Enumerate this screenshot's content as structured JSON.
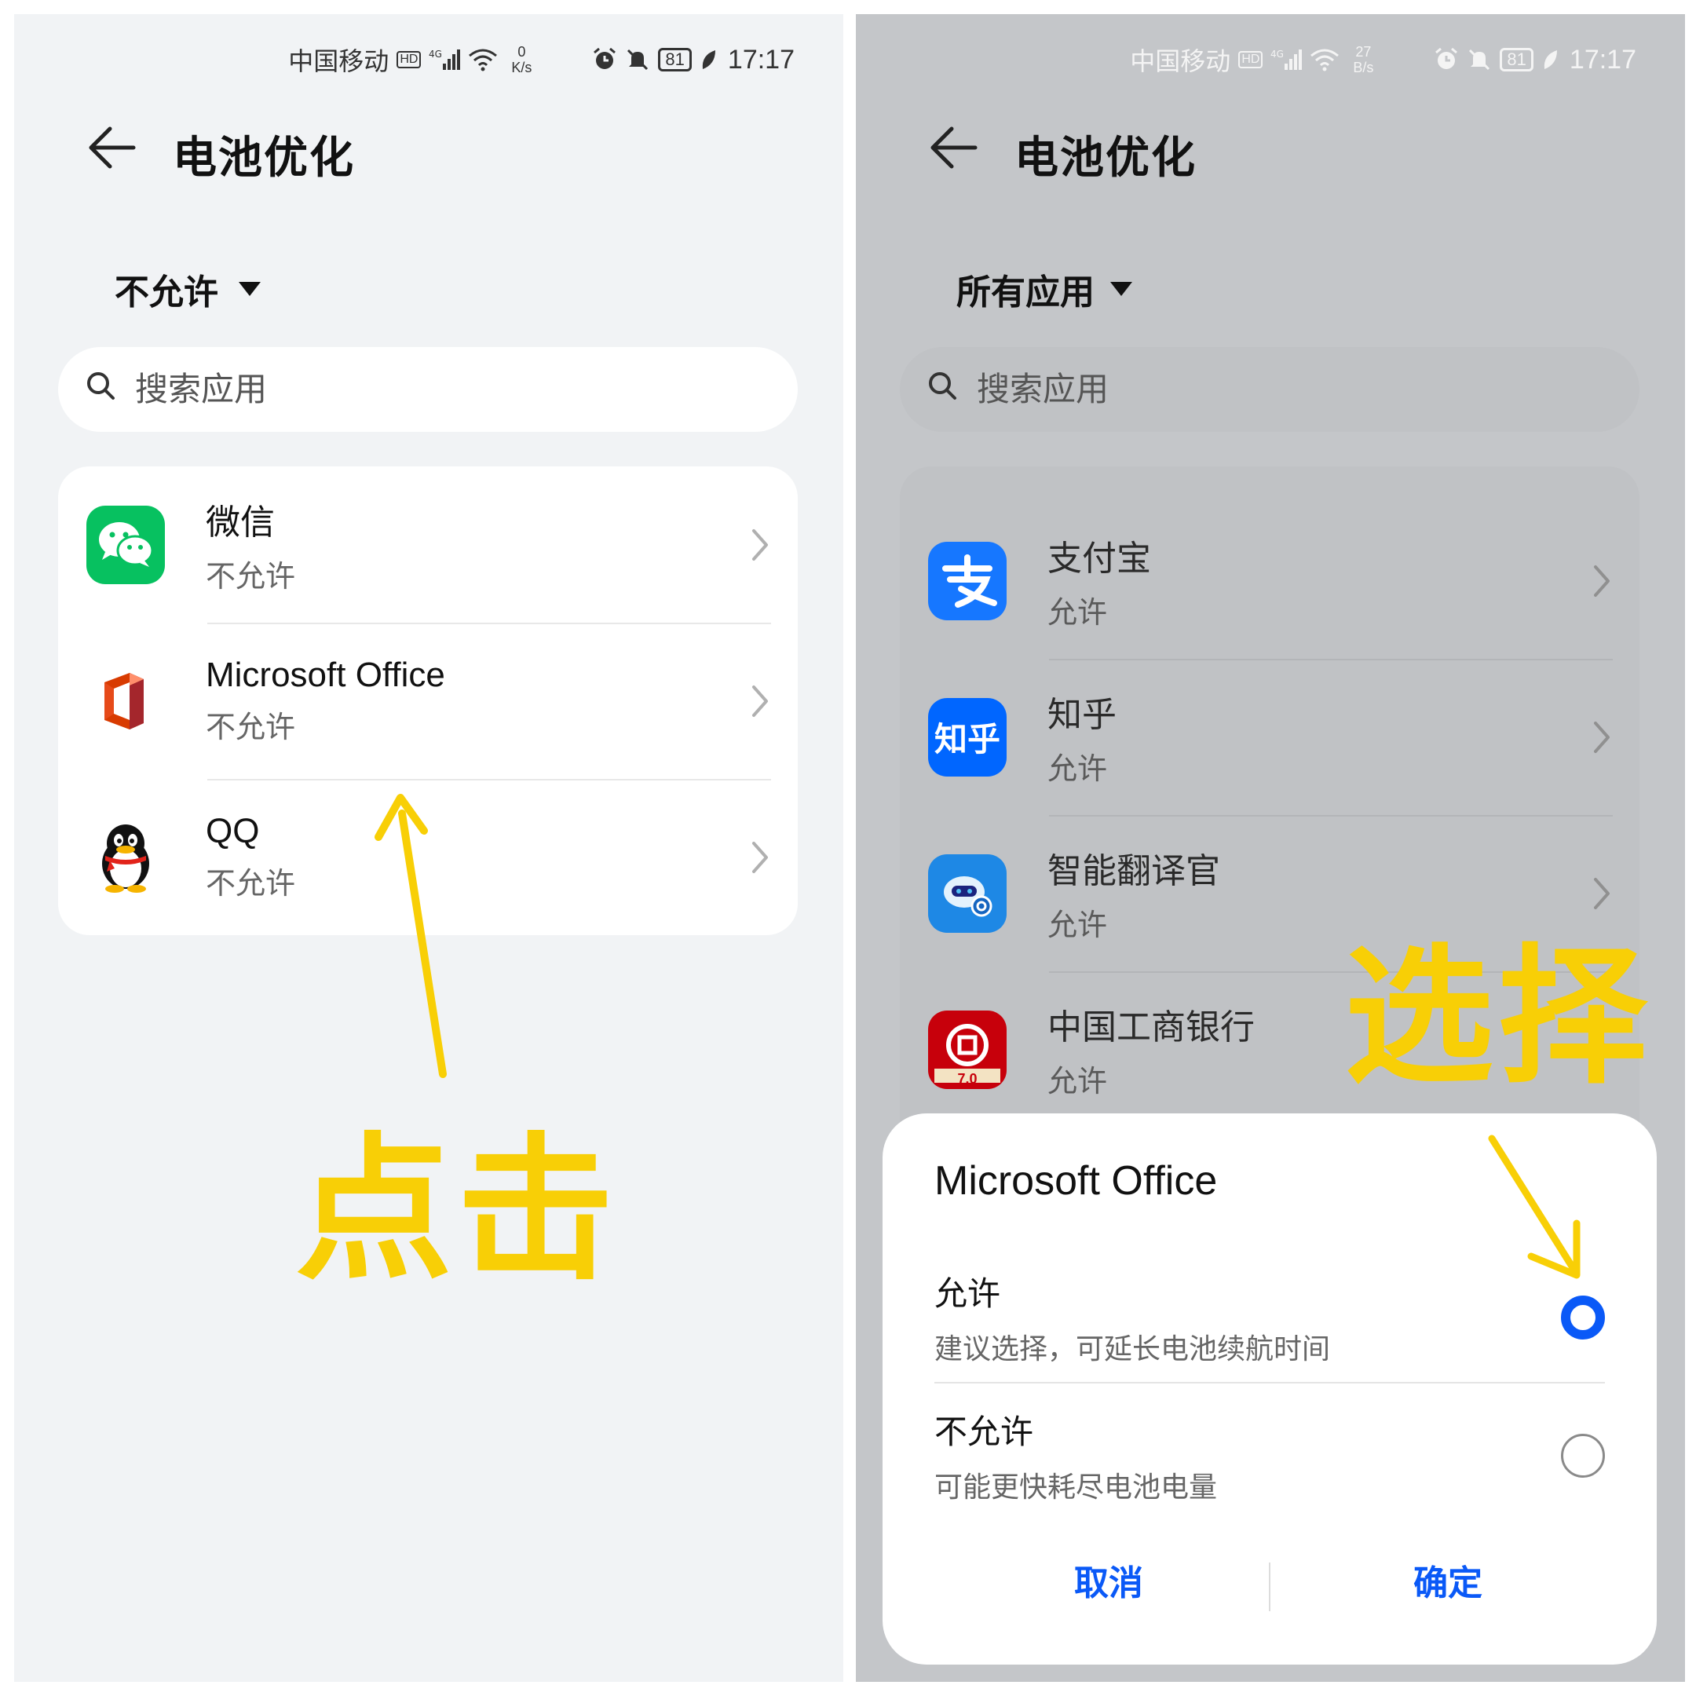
{
  "left": {
    "status": {
      "carrier": "中国移动",
      "hd": "HD",
      "net": "⁴ᴳ",
      "speed_value": "0",
      "speed_unit": "K/s",
      "battery": "81",
      "time": "17:17"
    },
    "header": {
      "title": "电池优化"
    },
    "filter": {
      "label": "不允许"
    },
    "search": {
      "placeholder": "搜索应用"
    },
    "apps": [
      {
        "name": "微信",
        "status": "不允许"
      },
      {
        "name": "Microsoft Office",
        "status": "不允许"
      },
      {
        "name": "QQ",
        "status": "不允许"
      }
    ],
    "annotation": "点击"
  },
  "right": {
    "status": {
      "carrier": "中国移动",
      "hd": "HD",
      "net": "⁴ᴳ",
      "speed_value": "27",
      "speed_unit": "B/s",
      "battery": "81",
      "time": "17:17"
    },
    "header": {
      "title": "电池优化"
    },
    "filter": {
      "label": "所有应用"
    },
    "search": {
      "placeholder": "搜索应用"
    },
    "apps": [
      {
        "name": "支付宝",
        "status": "允许"
      },
      {
        "name": "知乎",
        "status": "允许"
      },
      {
        "name": "智能翻译官",
        "status": "允许"
      },
      {
        "name": "中国工商银行",
        "status": "允许"
      }
    ],
    "icbc_version": "7.0",
    "zhihu_icon_text": "知乎",
    "annotation": "选择",
    "dialog": {
      "title": "Microsoft Office",
      "options": [
        {
          "label": "允许",
          "desc": "建议选择，可延长电池续航时间",
          "selected": true
        },
        {
          "label": "不允许",
          "desc": "可能更快耗尽电池电量",
          "selected": false
        }
      ],
      "cancel": "取消",
      "confirm": "确定"
    }
  },
  "colors": {
    "accent": "#0a59f7",
    "annotation": "#f8cf06",
    "wechat": "#07c160",
    "alipay": "#1677ff",
    "zhihu": "#0066ff",
    "icbc": "#c7000b"
  }
}
